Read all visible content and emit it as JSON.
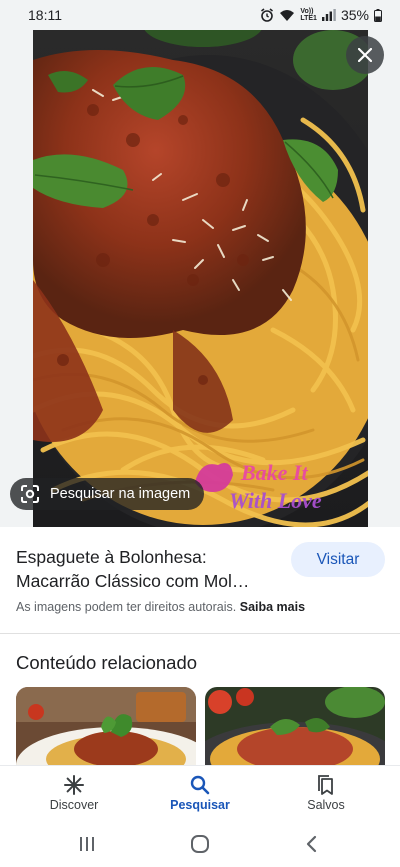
{
  "status_bar": {
    "time": "18:11",
    "network_label_top": "Vo))",
    "network_label_bottom": "LTE1",
    "battery": "35%"
  },
  "viewer": {
    "close_icon": "close-icon",
    "lens_button_label": "Pesquisar na imagem",
    "watermark_line1": "Bake It",
    "watermark_line2": "With Love"
  },
  "result": {
    "title_line1": "Espaguete à Bolonhesa:",
    "title_line2": "Macarrão Clássico com Mol…",
    "visit_label": "Visitar",
    "copyright_text": "As imagens podem ter direitos autorais.",
    "learn_more": "Saiba mais"
  },
  "related": {
    "heading": "Conteúdo relacionado"
  },
  "bottom_nav": {
    "items": [
      {
        "label": "Discover",
        "icon": "asterisk-icon",
        "active": false
      },
      {
        "label": "Pesquisar",
        "icon": "search-icon",
        "active": true
      },
      {
        "label": "Salvos",
        "icon": "bookmarks-icon",
        "active": false
      }
    ]
  },
  "colors": {
    "accent": "#1a56b8",
    "visit_bg": "#e8f0fe",
    "viewer_bg": "#f1f3f4"
  }
}
